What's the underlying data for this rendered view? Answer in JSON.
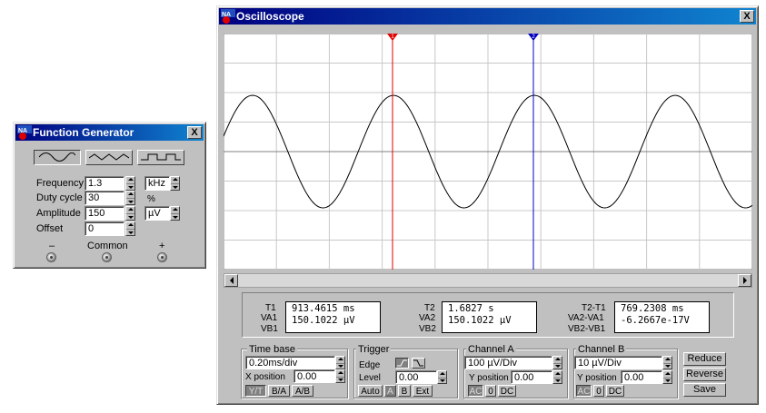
{
  "function_generator": {
    "title": "Function Generator",
    "close_label": "X",
    "waveforms": [
      "sine-icon",
      "triangle-icon",
      "square-icon"
    ],
    "selected_waveform": "sine",
    "frequency": {
      "label": "Frequency",
      "value": "1.3",
      "unit": "kHz"
    },
    "duty_cycle": {
      "label": "Duty cycle",
      "value": "30",
      "unit": "%"
    },
    "amplitude": {
      "label": "Amplitude",
      "value": "150",
      "unit": "µV"
    },
    "offset": {
      "label": "Offset",
      "value": "0"
    },
    "terminals": {
      "minus": "–",
      "common": "Common",
      "plus": "+"
    }
  },
  "oscilloscope": {
    "title": "Oscilloscope",
    "close_label": "X",
    "colors": {
      "screen_bg": "#ffffff",
      "grid": "#c8c8c8",
      "trace": "#000000",
      "cursor1": "#e00000",
      "cursor2": "#0000c0"
    },
    "cursors": {
      "c1_label": "1",
      "c2_label": "2"
    },
    "readouts": {
      "t1": {
        "label": "T1",
        "value": "913.4615 ms"
      },
      "va1": {
        "label": "VA1",
        "value": "150.1022 µV"
      },
      "vb1": {
        "label": "VB1",
        "value": ""
      },
      "t2": {
        "label": "T2",
        "value": "1.6827 s"
      },
      "va2": {
        "label": "VA2",
        "value": "150.1022 µV"
      },
      "vb2": {
        "label": "VB2",
        "value": ""
      },
      "dt": {
        "label": "T2-T1",
        "value": "769.2308 ms"
      },
      "dva": {
        "label": "VA2-VA1",
        "value": "-6.2667e-17V"
      },
      "dvb": {
        "label": "VB2-VB1",
        "value": ""
      }
    },
    "time_base": {
      "title": "Time base",
      "scale": "0.20ms/div",
      "x_position_label": "X position",
      "x_position": "0.00",
      "modes": [
        "Y/T",
        "B/A",
        "A/B"
      ],
      "selected_mode": "Y/T"
    },
    "trigger": {
      "title": "Trigger",
      "edge_label": "Edge",
      "level_label": "Level",
      "level": "0.00",
      "sources": [
        "Auto",
        "A",
        "B",
        "Ext"
      ],
      "selected_source": "Auto"
    },
    "channel_a": {
      "title": "Channel A",
      "scale": "100 µV/Div",
      "y_position_label": "Y position",
      "y_position": "0.00",
      "coupling": [
        "AC",
        "0",
        "DC"
      ],
      "selected_coupling": "AC"
    },
    "channel_b": {
      "title": "Channel B",
      "scale": "10 µV/Div",
      "y_position_label": "Y position",
      "y_position": "0.00",
      "coupling": [
        "AC",
        "0",
        "DC"
      ],
      "selected_coupling": "AC"
    },
    "buttons": {
      "reduce": "Reduce",
      "reverse": "Reverse",
      "save": "Save"
    }
  }
}
